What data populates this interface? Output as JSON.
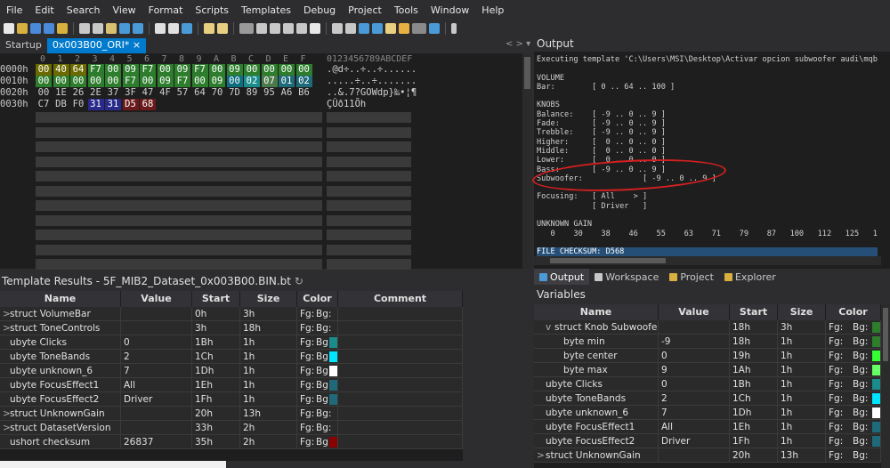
{
  "menu": [
    "File",
    "Edit",
    "Search",
    "View",
    "Format",
    "Scripts",
    "Templates",
    "Debug",
    "Project",
    "Tools",
    "Window",
    "Help"
  ],
  "tabs": {
    "startup": "Startup",
    "active": "0x003B00_ORI*"
  },
  "hex": {
    "header_cols": [
      "0",
      "1",
      "2",
      "3",
      "4",
      "5",
      "6",
      "7",
      "8",
      "9",
      "A",
      "B",
      "C",
      "D",
      "E",
      "F"
    ],
    "header_ascii": "0123456789ABCDEF",
    "rows": [
      {
        "addr": "0000h",
        "bytes": [
          "00",
          "40",
          "64",
          "F7",
          "00",
          "09",
          "F7",
          "00",
          "09",
          "F7",
          "00",
          "09",
          "00",
          "00",
          "00",
          "00"
        ],
        "colors": [
          "#6a6a00",
          "#6a6a00",
          "#6a6a00",
          "#2d7d2d",
          "#2d7d2d",
          "#2d7d2d",
          "#2d7d2d",
          "#2d7d2d",
          "#2d7d2d",
          "#2d7d2d",
          "#2d7d2d",
          "#2d7d2d",
          "#2d7d2d",
          "#2d7d2d",
          "#2d7d2d",
          "#2d7d2d"
        ],
        "ascii": ".@d÷..÷..÷......"
      },
      {
        "addr": "0010h",
        "bytes": [
          "00",
          "00",
          "00",
          "00",
          "00",
          "F7",
          "00",
          "09",
          "F7",
          "00",
          "09",
          "00",
          "02",
          "07",
          "01",
          "02"
        ],
        "colors": [
          "#2d7d2d",
          "#2d7d2d",
          "#2d7d2d",
          "#2d7d2d",
          "#2d7d2d",
          "#2d7d2d",
          "#2d7d2d",
          "#2d7d2d",
          "#2d7d2d",
          "#2d7d2d",
          "#2d7d2d",
          "#0c6e80",
          "#1a8c8c",
          "#4a7a4a",
          "#1f6a7a",
          "#1f6a7a"
        ],
        "ascii": ".....÷..÷......."
      },
      {
        "addr": "0020h",
        "bytes": [
          "00",
          "1E",
          "26",
          "2E",
          "37",
          "3F",
          "47",
          "4F",
          "57",
          "64",
          "70",
          "7D",
          "89",
          "95",
          "A6",
          "B6"
        ],
        "colors": [
          "",
          "",
          "",
          "",
          "",
          "",
          "",
          "",
          "",
          "",
          "",
          "",
          "",
          "",
          "",
          ""
        ],
        "ascii": "..&.7?GOWdp}‰•¦¶"
      },
      {
        "addr": "0030h",
        "bytes": [
          "C7",
          "DB",
          "F0",
          "31",
          "31",
          "D5",
          "68"
        ],
        "colors": [
          "",
          "",
          "",
          "#2a2a8a",
          "#2a2a8a",
          "#6a1a1a",
          "#6a1a1a"
        ],
        "ascii": "ÇÛð11Õh"
      }
    ]
  },
  "output": {
    "title": "Output",
    "lines": [
      "Executing template 'C:\\Users\\MSI\\Desktop\\Activar opcion subwoofer audi\\mqb",
      "",
      "VOLUME",
      "Bar:        [ 0 .. 64 .. 100 ]",
      "",
      "KNOBS",
      "Balance:    [ -9 .. 0 .. 9 ]",
      "Fade:       [ -9 .. 0 .. 9 ]",
      "Trebble:    [ -9 .. 0 .. 9 ]",
      "Higher:     [  0 .. 0 .. 0 ]",
      "Middle:     [  0 .. 0 .. 0 ]",
      "Lower:      [  0 .. 0 .. 0 ]",
      "Bass:       [ -9 .. 0 .. 9 ]",
      "Subwoofer:             [ -9 .. 0 .. 9 ]",
      "",
      "Focusing:   [ All    > ]",
      "            [ Driver   ]",
      "",
      "UNKNOWN GAIN",
      "   0    30    38    46    55    63    71    79    87   100   112   125   1",
      "",
      "FILE CHECKSUM: D568"
    ],
    "tabs": [
      "Output",
      "Workspace",
      "Project",
      "Explorer"
    ]
  },
  "template_results": {
    "title": "Template Results - 5F_MIB2_Dataset_0x003B00.BIN.bt",
    "columns": [
      "Name",
      "Value",
      "Start",
      "Size",
      "Color",
      "Comment"
    ],
    "rows": [
      {
        "expand": ">",
        "name": "struct VolumeBar",
        "value": "",
        "start": "0h",
        "size": "3h",
        "fg": "Fg:",
        "bg": "Bg:",
        "swatch": ""
      },
      {
        "expand": ">",
        "name": "struct ToneControls",
        "value": "",
        "start": "3h",
        "size": "18h",
        "fg": "Fg:",
        "bg": "Bg:",
        "swatch": ""
      },
      {
        "expand": "",
        "name": "ubyte Clicks",
        "value": "0",
        "start": "1Bh",
        "size": "1h",
        "fg": "Fg:",
        "bg": "Bg:",
        "swatch": "#1a8c8c"
      },
      {
        "expand": "",
        "name": "ubyte ToneBands",
        "value": "2",
        "start": "1Ch",
        "size": "1h",
        "fg": "Fg:",
        "bg": "Bg:",
        "swatch": "#00e5ff"
      },
      {
        "expand": "",
        "name": "ubyte unknown_6",
        "value": "7",
        "start": "1Dh",
        "size": "1h",
        "fg": "Fg:",
        "bg": "Bg:",
        "swatch": "#ffffff"
      },
      {
        "expand": "",
        "name": "ubyte FocusEffect1",
        "value": "All",
        "start": "1Eh",
        "size": "1h",
        "fg": "Fg:",
        "bg": "Bg:",
        "swatch": "#1f6a7a"
      },
      {
        "expand": "",
        "name": "ubyte FocusEffect2",
        "value": "Driver",
        "start": "1Fh",
        "size": "1h",
        "fg": "Fg:",
        "bg": "Bg:",
        "swatch": "#1f6a7a"
      },
      {
        "expand": ">",
        "name": "struct UnknownGain",
        "value": "",
        "start": "20h",
        "size": "13h",
        "fg": "Fg:",
        "bg": "Bg:",
        "swatch": ""
      },
      {
        "expand": ">",
        "name": "struct DatasetVersion",
        "value": "",
        "start": "33h",
        "size": "2h",
        "fg": "Fg:",
        "bg": "Bg:",
        "swatch": ""
      },
      {
        "expand": "",
        "name": "ushort checksum",
        "value": "26837",
        "start": "35h",
        "size": "2h",
        "fg": "Fg:",
        "bg": "Bg:",
        "swatch": "#8b0000"
      }
    ]
  },
  "variables": {
    "title": "Variables",
    "columns": [
      "Name",
      "Value",
      "Start",
      "Size",
      "Color"
    ],
    "rows": [
      {
        "expand": "v",
        "indent": 1,
        "name": "struct Knob Subwoofer",
        "value": "",
        "start": "18h",
        "size": "3h",
        "fg": "Fg:",
        "bg": "Bg:",
        "swatch": "#2d7d2d"
      },
      {
        "expand": "",
        "indent": 2,
        "name": "byte min",
        "value": "-9",
        "start": "18h",
        "size": "1h",
        "fg": "Fg:",
        "bg": "Bg:",
        "swatch": "#2d7d2d"
      },
      {
        "expand": "",
        "indent": 2,
        "name": "byte center",
        "value": "0",
        "start": "19h",
        "size": "1h",
        "fg": "Fg:",
        "bg": "Bg:",
        "swatch": "#33ff33"
      },
      {
        "expand": "",
        "indent": 2,
        "name": "byte max",
        "value": "9",
        "start": "1Ah",
        "size": "1h",
        "fg": "Fg:",
        "bg": "Bg:",
        "swatch": "#66ff66"
      },
      {
        "expand": "",
        "indent": 0,
        "name": "ubyte Clicks",
        "value": "0",
        "start": "1Bh",
        "size": "1h",
        "fg": "Fg:",
        "bg": "Bg:",
        "swatch": "#1a8c8c"
      },
      {
        "expand": "",
        "indent": 0,
        "name": "ubyte ToneBands",
        "value": "2",
        "start": "1Ch",
        "size": "1h",
        "fg": "Fg:",
        "bg": "Bg:",
        "swatch": "#00e5ff"
      },
      {
        "expand": "",
        "indent": 0,
        "name": "ubyte unknown_6",
        "value": "7",
        "start": "1Dh",
        "size": "1h",
        "fg": "Fg:",
        "bg": "Bg:",
        "swatch": "#ffffff"
      },
      {
        "expand": "",
        "indent": 0,
        "name": "ubyte FocusEffect1",
        "value": "All",
        "start": "1Eh",
        "size": "1h",
        "fg": "Fg:",
        "bg": "Bg:",
        "swatch": "#1f6a7a"
      },
      {
        "expand": "",
        "indent": 0,
        "name": "ubyte FocusEffect2",
        "value": "Driver",
        "start": "1Fh",
        "size": "1h",
        "fg": "Fg:",
        "bg": "Bg:",
        "swatch": "#1f6a7a"
      },
      {
        "expand": ">",
        "indent": 0,
        "name": "struct UnknownGain",
        "value": "",
        "start": "20h",
        "size": "13h",
        "fg": "Fg:",
        "bg": "Bg:",
        "swatch": ""
      }
    ]
  }
}
